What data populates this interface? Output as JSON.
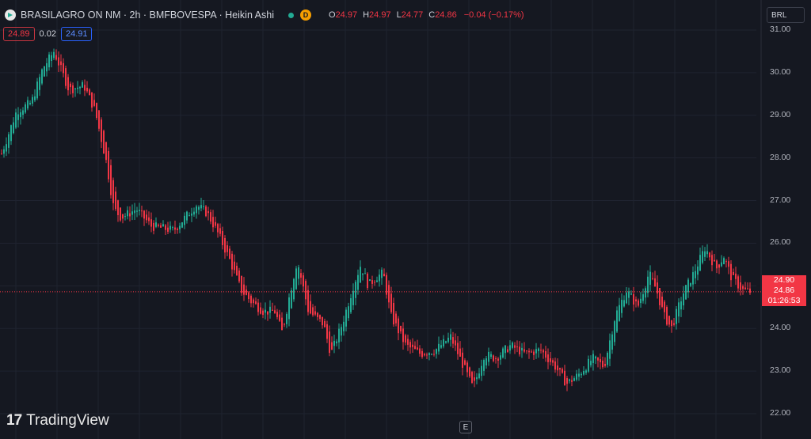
{
  "header": {
    "title": "BRASILAGRO ON NM · 2h · BMFBOVESPA · Heikin Ashi",
    "market_badge": "D",
    "ohlc": {
      "o_label": "O",
      "o_value": "24.97",
      "h_label": "H",
      "h_value": "24.97",
      "l_label": "L",
      "l_value": "24.77",
      "c_label": "C",
      "c_value": "24.86",
      "change": "−0.04 (−0.17%)"
    },
    "bid": "24.89",
    "spread": "0.02",
    "ask": "24.91"
  },
  "currency": "BRL",
  "price_scale": {
    "ticks": [
      "31.00",
      "30.00",
      "29.00",
      "28.00",
      "27.00",
      "26.00",
      "25.00",
      "24.00",
      "23.00",
      "22.00"
    ],
    "current_tags": [
      "24.90",
      "24.86",
      "01:26:53"
    ]
  },
  "footer": {
    "logo_mark": "17",
    "logo_text": "TradingView",
    "e_button": "E"
  },
  "colors": {
    "background": "#151821",
    "up": "#22ab94",
    "down": "#f23645",
    "grid": "#1f2330"
  },
  "chart_data": {
    "type": "candlestick (Heikin Ashi)",
    "ylim": [
      22.0,
      31.0
    ],
    "last_price": 24.86,
    "ticks": [
      31,
      30,
      29,
      28,
      27,
      26,
      25,
      24,
      23,
      22
    ],
    "path": [
      {
        "x": 0,
        "y": 28.1
      },
      {
        "x": 0.02,
        "y": 29.1
      },
      {
        "x": 0.04,
        "y": 29.3
      },
      {
        "x": 0.055,
        "y": 30.1
      },
      {
        "x": 0.07,
        "y": 30.5
      },
      {
        "x": 0.09,
        "y": 29.6
      },
      {
        "x": 0.11,
        "y": 29.7
      },
      {
        "x": 0.125,
        "y": 29.1
      },
      {
        "x": 0.14,
        "y": 27.9
      },
      {
        "x": 0.15,
        "y": 26.8
      },
      {
        "x": 0.16,
        "y": 26.6
      },
      {
        "x": 0.18,
        "y": 26.8
      },
      {
        "x": 0.2,
        "y": 26.4
      },
      {
        "x": 0.23,
        "y": 26.3
      },
      {
        "x": 0.245,
        "y": 26.6
      },
      {
        "x": 0.26,
        "y": 26.9
      },
      {
        "x": 0.275,
        "y": 26.7
      },
      {
        "x": 0.29,
        "y": 26.2
      },
      {
        "x": 0.305,
        "y": 25.6
      },
      {
        "x": 0.32,
        "y": 24.9
      },
      {
        "x": 0.335,
        "y": 24.6
      },
      {
        "x": 0.35,
        "y": 24.4
      },
      {
        "x": 0.365,
        "y": 24.4
      },
      {
        "x": 0.375,
        "y": 23.9
      },
      {
        "x": 0.385,
        "y": 24.8
      },
      {
        "x": 0.395,
        "y": 25.6
      },
      {
        "x": 0.41,
        "y": 24.4
      },
      {
        "x": 0.43,
        "y": 24.1
      },
      {
        "x": 0.44,
        "y": 23.4
      },
      {
        "x": 0.455,
        "y": 24.1
      },
      {
        "x": 0.47,
        "y": 25.0
      },
      {
        "x": 0.48,
        "y": 25.5
      },
      {
        "x": 0.49,
        "y": 25.0
      },
      {
        "x": 0.5,
        "y": 25.2
      },
      {
        "x": 0.51,
        "y": 25.3
      },
      {
        "x": 0.52,
        "y": 24.3
      },
      {
        "x": 0.54,
        "y": 23.6
      },
      {
        "x": 0.56,
        "y": 23.4
      },
      {
        "x": 0.58,
        "y": 23.5
      },
      {
        "x": 0.6,
        "y": 23.8
      },
      {
        "x": 0.615,
        "y": 23.2
      },
      {
        "x": 0.63,
        "y": 22.6
      },
      {
        "x": 0.645,
        "y": 23.4
      },
      {
        "x": 0.66,
        "y": 23.3
      },
      {
        "x": 0.68,
        "y": 23.6
      },
      {
        "x": 0.7,
        "y": 23.4
      },
      {
        "x": 0.72,
        "y": 23.5
      },
      {
        "x": 0.74,
        "y": 23.1
      },
      {
        "x": 0.755,
        "y": 22.7
      },
      {
        "x": 0.77,
        "y": 22.9
      },
      {
        "x": 0.79,
        "y": 23.3
      },
      {
        "x": 0.805,
        "y": 23.1
      },
      {
        "x": 0.82,
        "y": 24.3
      },
      {
        "x": 0.835,
        "y": 24.9
      },
      {
        "x": 0.85,
        "y": 24.5
      },
      {
        "x": 0.865,
        "y": 25.3
      },
      {
        "x": 0.875,
        "y": 24.9
      },
      {
        "x": 0.885,
        "y": 24.3
      },
      {
        "x": 0.895,
        "y": 24.0
      },
      {
        "x": 0.91,
        "y": 24.8
      },
      {
        "x": 0.925,
        "y": 25.3
      },
      {
        "x": 0.94,
        "y": 25.9
      },
      {
        "x": 0.955,
        "y": 25.4
      },
      {
        "x": 0.965,
        "y": 25.7
      },
      {
        "x": 0.975,
        "y": 25.2
      },
      {
        "x": 0.99,
        "y": 24.9
      },
      {
        "x": 1.0,
        "y": 24.86
      }
    ]
  }
}
